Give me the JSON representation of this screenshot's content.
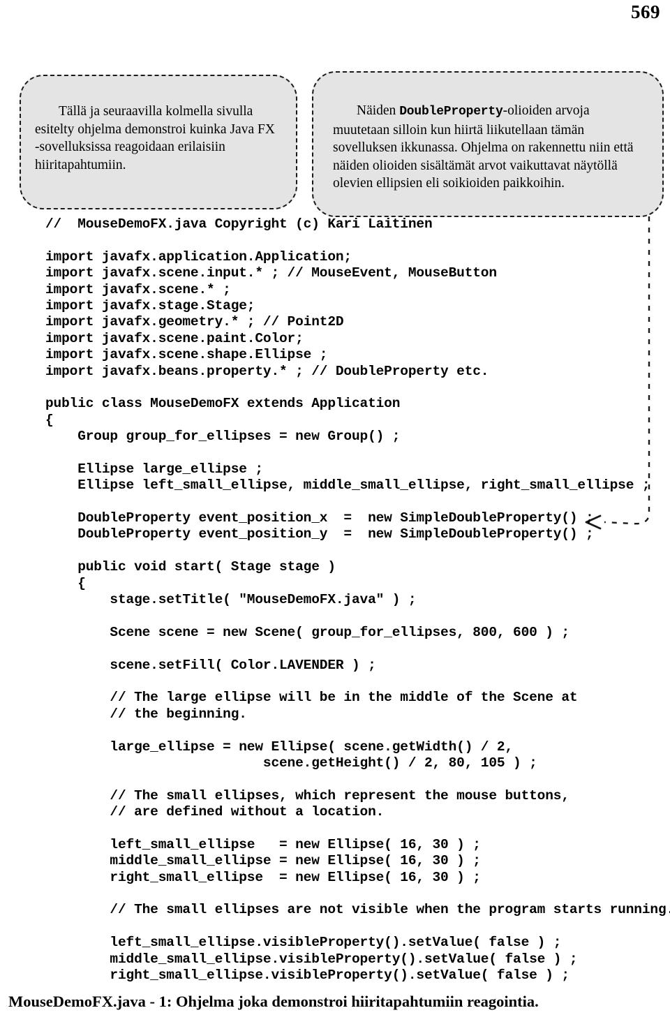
{
  "page": {
    "number": "569"
  },
  "callouts": {
    "left": {
      "text": "Tällä ja seuraavilla kolmella sivulla esitelty ohjelma demonstroi kuinka Java FX -sovelluksissa reagoidaan erilaisiin hiiritapahtumiin."
    },
    "right": {
      "text_before": "Näiden ",
      "mono_term": "DoubleProperty",
      "text_after": "-olioiden arvoja muutetaan silloin kun hiirtä liikutellaan tämän sovelluksen ikkunassa. Ohjelma on rakennettu niin että näiden olioiden sisältämät arvot vaikuttavat näytöllä olevien ellipsien eli soikioiden paikkoihin."
    }
  },
  "code": {
    "lines": [
      "//  MouseDemoFX.java Copyright (c) Kari Laitinen",
      "",
      "import javafx.application.Application;",
      "import javafx.scene.input.* ; // MouseEvent, MouseButton",
      "import javafx.scene.* ;",
      "import javafx.stage.Stage;",
      "import javafx.geometry.* ; // Point2D",
      "import javafx.scene.paint.Color;",
      "import javafx.scene.shape.Ellipse ;",
      "import javafx.beans.property.* ; // DoubleProperty etc.",
      "",
      "public class MouseDemoFX extends Application",
      "{",
      "    Group group_for_ellipses = new Group() ;",
      "",
      "    Ellipse large_ellipse ;",
      "    Ellipse left_small_ellipse, middle_small_ellipse, right_small_ellipse ;",
      "",
      "    DoubleProperty event_position_x  =  new SimpleDoubleProperty() ;",
      "    DoubleProperty event_position_y  =  new SimpleDoubleProperty() ;",
      "",
      "    public void start( Stage stage )",
      "    {",
      "        stage.setTitle( \"MouseDemoFX.java\" ) ;",
      "",
      "        Scene scene = new Scene( group_for_ellipses, 800, 600 ) ;",
      "",
      "        scene.setFill( Color.LAVENDER ) ;",
      "",
      "        // The large ellipse will be in the middle of the Scene at",
      "        // the beginning.",
      "",
      "        large_ellipse = new Ellipse( scene.getWidth() / 2,",
      "                           scene.getHeight() / 2, 80, 105 ) ;",
      "",
      "        // The small ellipses, which represent the mouse buttons,",
      "        // are defined without a location.",
      "",
      "        left_small_ellipse   = new Ellipse( 16, 30 ) ;",
      "        middle_small_ellipse = new Ellipse( 16, 30 ) ;",
      "        right_small_ellipse  = new Ellipse( 16, 30 ) ;",
      "",
      "        // The small ellipses are not visible when the program starts running.",
      "",
      "        left_small_ellipse.visibleProperty().setValue( false ) ;",
      "        middle_small_ellipse.visibleProperty().setValue( false ) ;",
      "        right_small_ellipse.visibleProperty().setValue( false ) ;"
    ]
  },
  "footer": {
    "caption": "MouseDemoFX.java - 1:  Ohjelma joka demonstroi hiiritapahtumiin reagointia."
  },
  "colors": {
    "callout_fill": "#e4e4e4",
    "ink": "#000000",
    "page_background": "#ffffff"
  },
  "annotations": {
    "connector_target": "DoubleProperty event_position_x  =  new SimpleDoubleProperty() ;"
  }
}
